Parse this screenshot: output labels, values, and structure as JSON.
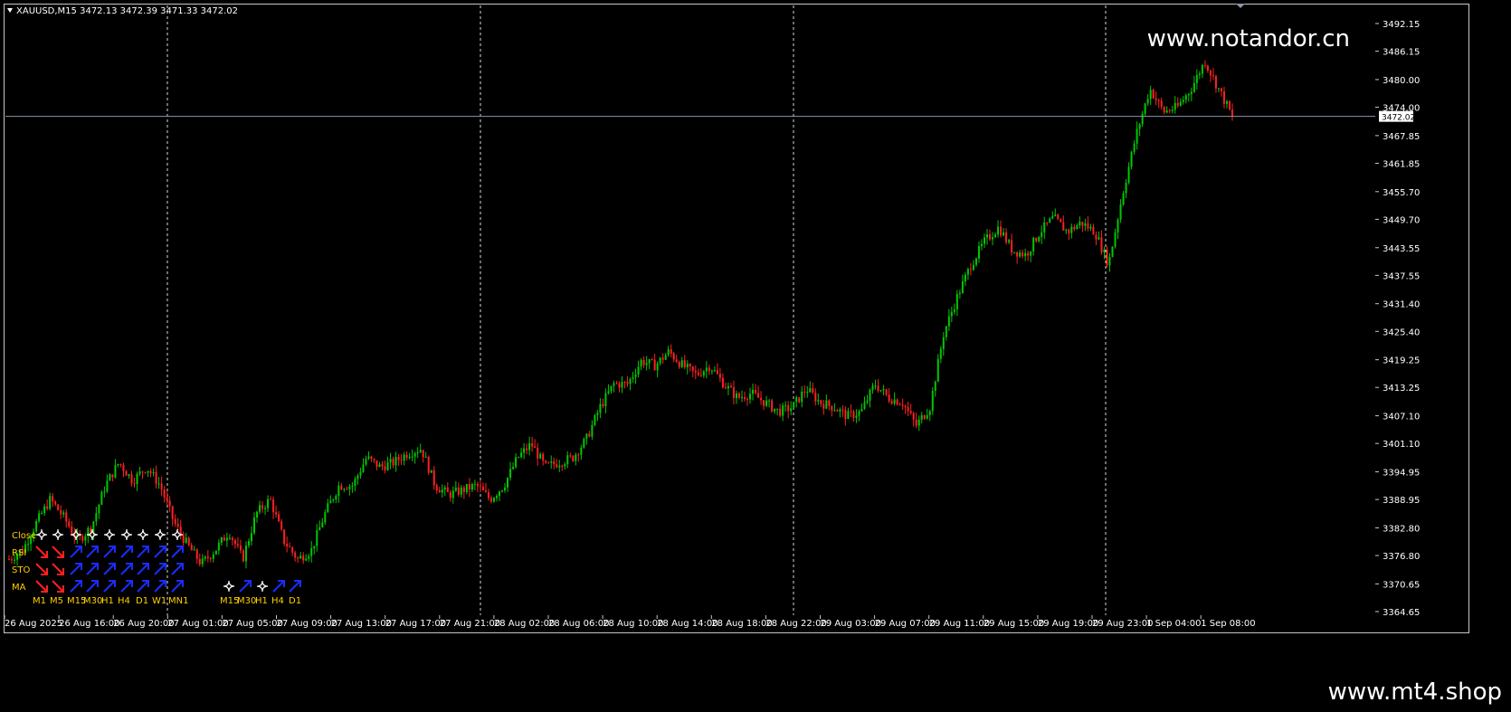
{
  "header": {
    "symbol_label": "XAUUSD,M15  3472.13 3472.39 3471.33 3472.02"
  },
  "watermark_top": "www.notandor.cn",
  "watermark_bottom": "www.mt4.shop",
  "colors": {
    "background": "#000000",
    "bull": "#00c800",
    "bear": "#ff2020",
    "grid": "#ffffff",
    "price_line": "#8a96a8",
    "indicator_label": "#ffd000",
    "arrow_up": "#1a2cff",
    "arrow_down": "#ff2020"
  },
  "price_axis": {
    "labels": [
      "3492.15",
      "3486.15",
      "3480.00",
      "3474.00",
      "3467.85",
      "3461.85",
      "3455.70",
      "3449.70",
      "3443.55",
      "3437.55",
      "3431.40",
      "3425.40",
      "3419.25",
      "3413.25",
      "3407.10",
      "3401.10",
      "3394.95",
      "3388.95",
      "3382.80",
      "3376.80",
      "3370.65",
      "3364.65"
    ],
    "current_price": "3472.02"
  },
  "time_axis": {
    "labels": [
      "26 Aug 2025",
      "26 Aug 16:00",
      "26 Aug 20:00",
      "27 Aug 01:00",
      "27 Aug 05:00",
      "27 Aug 09:00",
      "27 Aug 13:00",
      "27 Aug 17:00",
      "27 Aug 21:00",
      "28 Aug 02:00",
      "28 Aug 06:00",
      "28 Aug 10:00",
      "28 Aug 14:00",
      "28 Aug 18:00",
      "28 Aug 22:00",
      "29 Aug 03:00",
      "29 Aug 07:00",
      "29 Aug 11:00",
      "29 Aug 15:00",
      "29 Aug 19:00",
      "29 Aug 23:00",
      "1 Sep 04:00",
      "1 Sep 08:00"
    ]
  },
  "chart_data": {
    "type": "candlestick",
    "symbol": "XAUUSD",
    "timeframe": "M15",
    "ylim": [
      3362.5,
      3494.5
    ],
    "last": 3472.02,
    "path": [
      3376,
      3378,
      3384,
      3389,
      3385,
      3380,
      3383,
      3392,
      3397,
      3393,
      3396,
      3392,
      3384,
      3379,
      3375,
      3378,
      3382,
      3376,
      3386,
      3389,
      3380,
      3376,
      3378,
      3386,
      3392,
      3392,
      3398,
      3396,
      3397,
      3399,
      3400,
      3392,
      3390,
      3391,
      3392,
      3389,
      3392,
      3398,
      3401,
      3396,
      3397,
      3398,
      3402,
      3409,
      3414,
      3414,
      3419,
      3418,
      3421,
      3418,
      3416,
      3418,
      3414,
      3411,
      3412,
      3410,
      3408,
      3409,
      3413,
      3410,
      3409,
      3407,
      3408,
      3414,
      3411,
      3410,
      3405,
      3409,
      3425,
      3433,
      3440,
      3445,
      3448,
      3443,
      3442,
      3447,
      3450,
      3447,
      3449,
      3447,
      3440,
      3455,
      3468,
      3478,
      3473,
      3474,
      3478,
      3484,
      3478,
      3472
    ],
    "indicators": {
      "rows": [
        "Close",
        "RSI",
        "STO",
        "MA"
      ],
      "timeframes": [
        "M1",
        "M5",
        "M15",
        "M30",
        "H1",
        "H4",
        "D1",
        "W1",
        "MN1"
      ],
      "states": {
        "Close": [
          "star",
          "star",
          "star",
          "star",
          "star",
          "star",
          "star",
          "star",
          "star"
        ],
        "RSI": [
          "down",
          "down",
          "up",
          "up",
          "up",
          "up",
          "up",
          "up",
          "up"
        ],
        "STO": [
          "down",
          "down",
          "up",
          "up",
          "up",
          "up",
          "up",
          "up",
          "up"
        ],
        "MA": [
          "down",
          "down",
          "up",
          "up",
          "up",
          "up",
          "up",
          "up",
          "up"
        ]
      },
      "second_panel": {
        "timeframes": [
          "M15",
          "M30",
          "H1",
          "H4",
          "D1"
        ],
        "states": [
          "star",
          "up",
          "star",
          "up",
          "up"
        ]
      }
    }
  }
}
